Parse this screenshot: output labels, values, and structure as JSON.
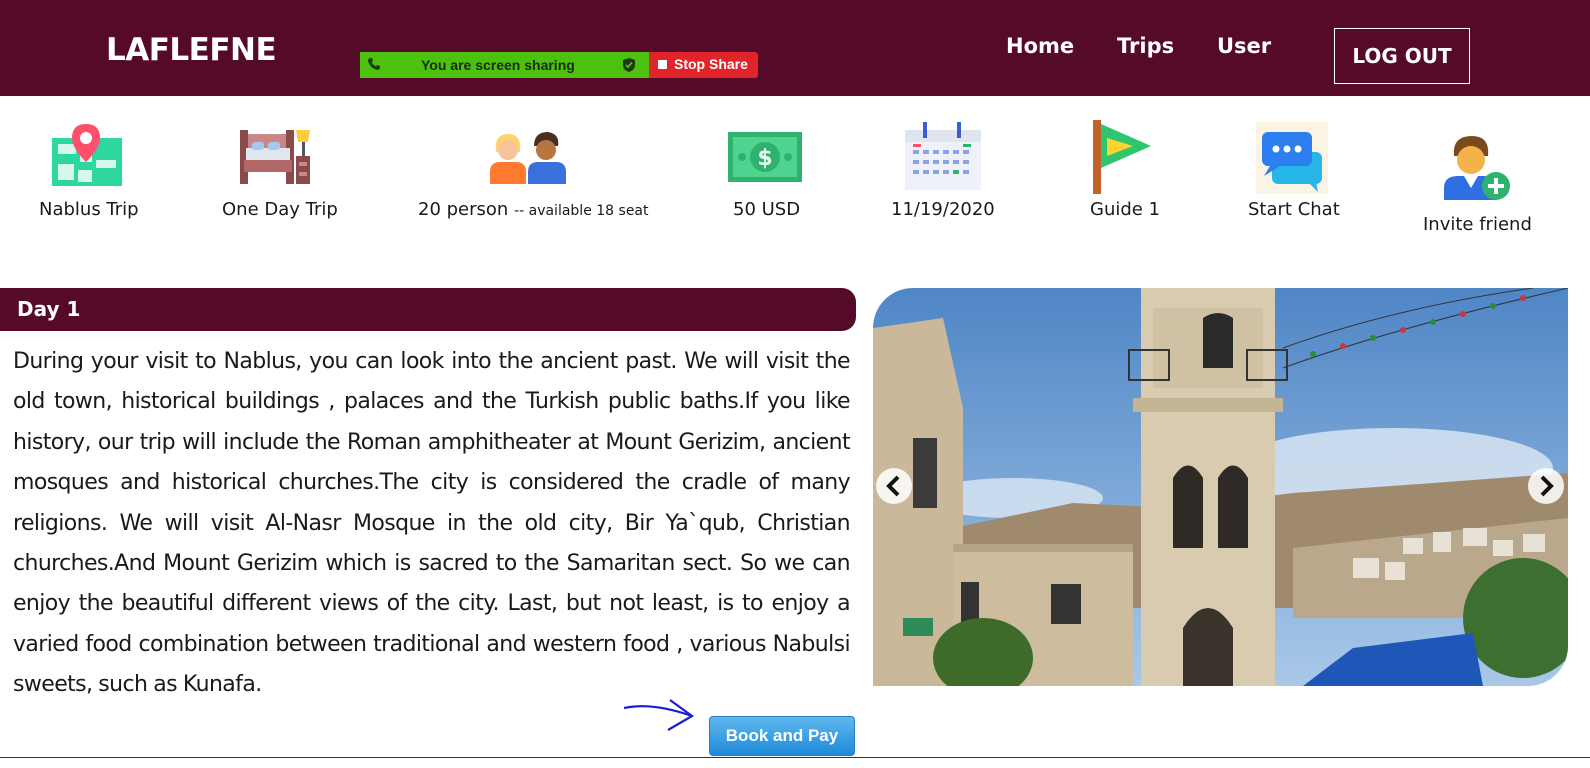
{
  "header": {
    "logo": "LAFLEFNE",
    "share_text": "You are screen sharing",
    "stop_share": "Stop Share",
    "nav": [
      "Home",
      "Trips",
      "User"
    ],
    "logout": "LOG OUT"
  },
  "info": {
    "trip_name": "Nablus Trip",
    "duration": "One Day Trip",
    "persons": "20 person",
    "seats": "-- available 18 seat",
    "price": "50 USD",
    "date": "11/19/2020",
    "guide": "Guide 1",
    "chat": "Start Chat",
    "invite": "Invite friend"
  },
  "day": {
    "title": "Day 1",
    "description": "During your visit to Nablus, you can look into the ancient past. We will visit the old town, historical buildings , palaces and the Turkish public baths.If you like history, our trip will include the Roman amphitheater at Mount Gerizim, ancient mosques and historical churches.The city is considered the cradle of many religions. We will visit Al-Nasr Mosque in the old city, Bir Ya`qub, Christian churches.And Mount Gerizim which is sacred to the Samaritan sect. So we can enjoy the beautiful different views of the city. Last, but not least, is to enjoy a varied food combination between traditional and western food , various Nabulsi sweets, such as Kunafa."
  },
  "book_button": "Book and Pay",
  "icons": [
    "map-pin-icon",
    "bed-icon",
    "people-icon",
    "money-icon",
    "calendar-icon",
    "flag-icon",
    "chat-icon",
    "add-user-icon",
    "phone-icon",
    "shield-icon",
    "chevron-left-icon",
    "chevron-right-icon"
  ],
  "colors": {
    "header_bg": "#560a29",
    "share_green": "#4cc20e",
    "share_red": "#e0242a",
    "button_blue": "#1e8ad8"
  }
}
